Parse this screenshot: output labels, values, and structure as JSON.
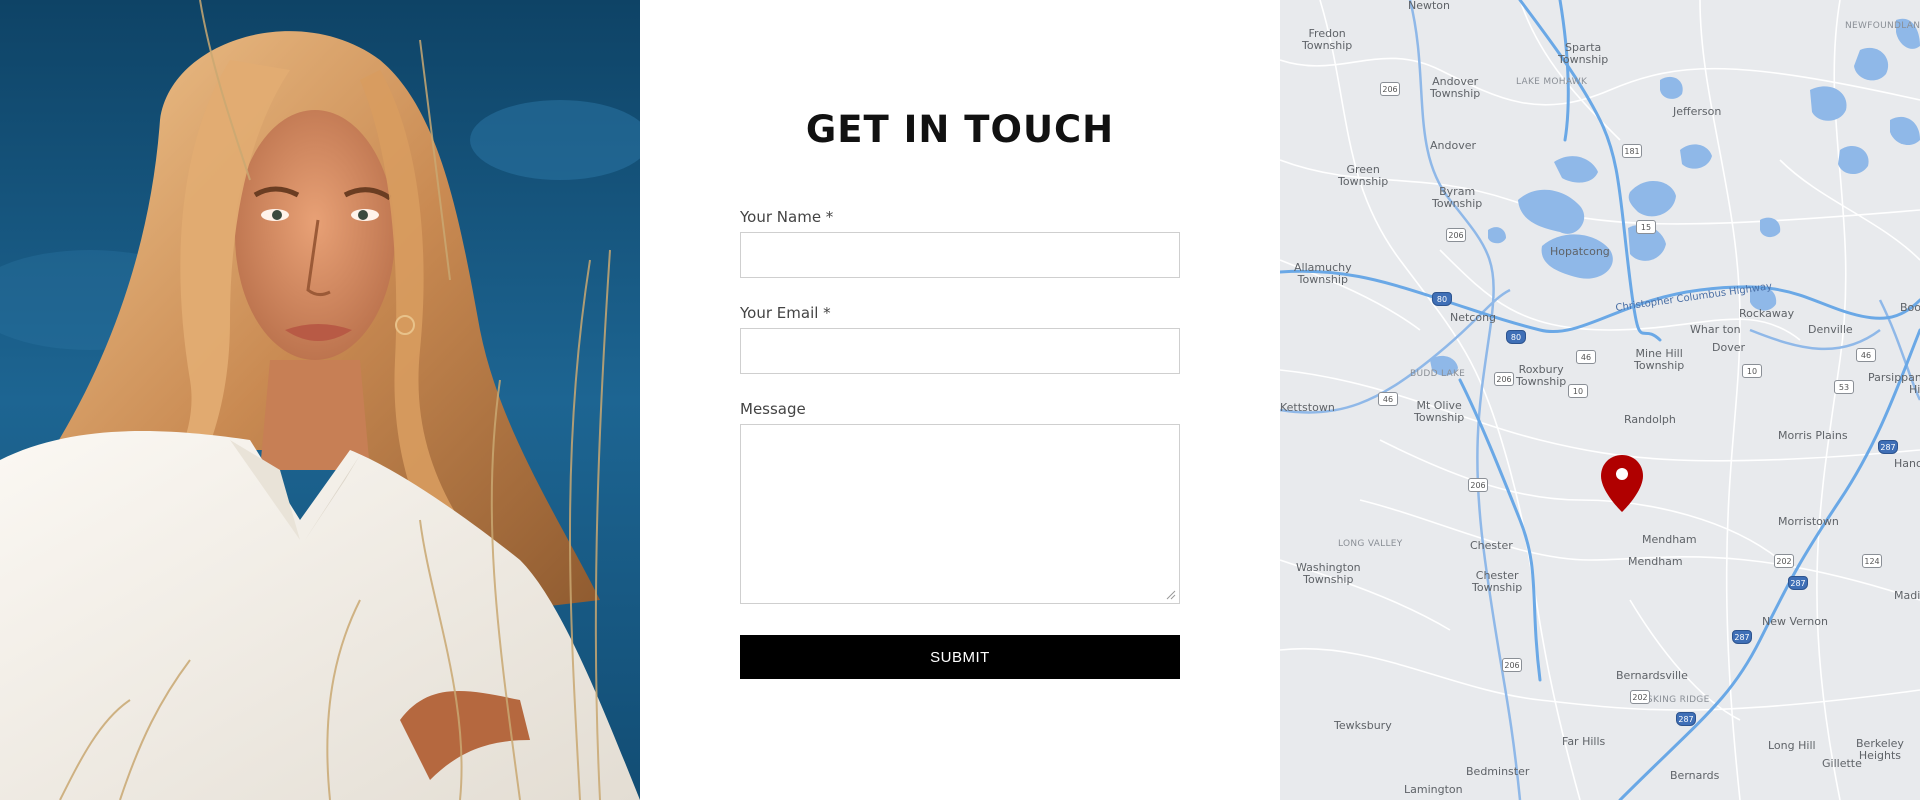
{
  "form": {
    "title": "GET IN TOUCH",
    "name_label": "Your Name *",
    "email_label": "Your Email *",
    "message_label": "Message",
    "submit_label": "SUBMIT"
  },
  "photo": {
    "subject": "woman-portrait",
    "colors": {
      "sky": "#1b5f8d",
      "hair": "#d9a06a",
      "shirt": "#f2efe9"
    }
  },
  "map": {
    "pin_color": "#b00000",
    "water_color": "#8fb8e8",
    "places": [
      {
        "name": "Newton"
      },
      {
        "name": "Fredon\nTownship"
      },
      {
        "name": "Sparta\nTownship"
      },
      {
        "name": "NEWFOUNDLAND"
      },
      {
        "name": "Andover\nTownship"
      },
      {
        "name": "LAKE MOHAWK"
      },
      {
        "name": "Jefferson"
      },
      {
        "name": "Andover"
      },
      {
        "name": "Green\nTownship"
      },
      {
        "name": "Byram\nTownship"
      },
      {
        "name": "Hopatcong"
      },
      {
        "name": "Allamuchy\nTownship"
      },
      {
        "name": "Christopher Columbus Highway"
      },
      {
        "name": "Netcong"
      },
      {
        "name": "Rockaway"
      },
      {
        "name": "Denville"
      },
      {
        "name": "Whar ton"
      },
      {
        "name": "Mine Hill\nTownship"
      },
      {
        "name": "Dover"
      },
      {
        "name": "BUDD LAKE"
      },
      {
        "name": "Roxbury\nTownship"
      },
      {
        "name": "Parsippany-\nHills"
      },
      {
        "name": "Kettstown"
      },
      {
        "name": "Mt Olive\nTownship"
      },
      {
        "name": "Randolph"
      },
      {
        "name": "Morris Plains"
      },
      {
        "name": "Hanov"
      },
      {
        "name": "LONG VALLEY"
      },
      {
        "name": "Chester"
      },
      {
        "name": "Mendham"
      },
      {
        "name": "Mendham"
      },
      {
        "name": "Morristown"
      },
      {
        "name": "Washington\nTownship"
      },
      {
        "name": "Chester\nTownship"
      },
      {
        "name": "New Vernon"
      },
      {
        "name": "Madis"
      },
      {
        "name": "Bernardsville"
      },
      {
        "name": "BASKING RIDGE"
      },
      {
        "name": "Tewksbury"
      },
      {
        "name": "Far Hills"
      },
      {
        "name": "Long Hill"
      },
      {
        "name": "Berkeley\nHeights"
      },
      {
        "name": "Gillette"
      },
      {
        "name": "Bedminster"
      },
      {
        "name": "Bernards"
      },
      {
        "name": "Lamington"
      },
      {
        "name": "Boo"
      }
    ],
    "shields": [
      {
        "label": "206"
      },
      {
        "label": "181"
      },
      {
        "label": "15"
      },
      {
        "label": "206"
      },
      {
        "label": "80"
      },
      {
        "label": "80"
      },
      {
        "label": "46"
      },
      {
        "label": "206"
      },
      {
        "label": "10"
      },
      {
        "label": "10"
      },
      {
        "label": "46"
      },
      {
        "label": "53"
      },
      {
        "label": "46"
      },
      {
        "label": "287"
      },
      {
        "label": "206"
      },
      {
        "label": "202"
      },
      {
        "label": "287"
      },
      {
        "label": "124"
      },
      {
        "label": "287"
      },
      {
        "label": "206"
      },
      {
        "label": "202"
      },
      {
        "label": "287"
      }
    ]
  }
}
